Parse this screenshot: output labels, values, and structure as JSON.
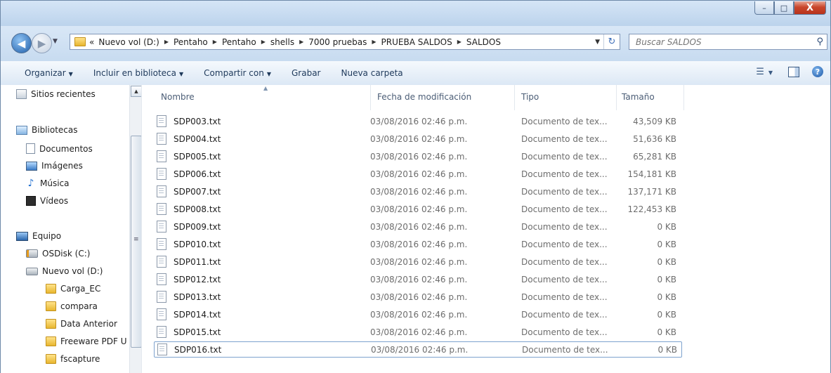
{
  "window": {
    "min_label": "–",
    "max_label": "□",
    "close_label": "X"
  },
  "nav_buttons": {
    "back_glyph": "◀",
    "forward_glyph": "▶",
    "drop_glyph": "▼"
  },
  "address": {
    "prefix": "«",
    "crumbs": [
      "Nuevo vol (D:)",
      "Pentaho",
      "Pentaho",
      "shells",
      "7000 pruebas",
      "PRUEBA SALDOS",
      "SALDOS"
    ],
    "sep_glyph": "▶",
    "dropdown_glyph": "▼",
    "refresh_glyph": "↻"
  },
  "search": {
    "placeholder": "Buscar SALDOS",
    "icon_glyph": "⚲"
  },
  "toolbar": {
    "organize": "Organizar",
    "include": "Incluir en biblioteca",
    "share": "Compartir con",
    "burn": "Grabar",
    "new_folder": "Nueva carpeta",
    "caret": "▼",
    "views_glyph": "☰",
    "preview_glyph": "▯",
    "help_glyph": "?"
  },
  "nav_pane": {
    "recent": "Sitios recientes",
    "libraries": "Bibliotecas",
    "documents": "Documentos",
    "images": "Imágenes",
    "music": "Música",
    "videos": "Vídeos",
    "computer": "Equipo",
    "osdisk": "OSDisk (C:)",
    "nuevo": "Nuevo vol (D:)",
    "folders": [
      "Carga_EC",
      "compara",
      "Data Anterior",
      "Freeware PDF U",
      "fscapture"
    ],
    "music_glyph": "♪",
    "scroll_up_glyph": "▲",
    "grip_glyph": "≡"
  },
  "columns": {
    "name": "Nombre",
    "date": "Fecha de modificación",
    "type": "Tipo",
    "size": "Tamaño",
    "sort_glyph": "▲"
  },
  "files": [
    {
      "name": "SDP003.txt",
      "date": "03/08/2016 02:46 p.m.",
      "type": "Documento de tex...",
      "size": "43,509 KB"
    },
    {
      "name": "SDP004.txt",
      "date": "03/08/2016 02:46 p.m.",
      "type": "Documento de tex...",
      "size": "51,636 KB"
    },
    {
      "name": "SDP005.txt",
      "date": "03/08/2016 02:46 p.m.",
      "type": "Documento de tex...",
      "size": "65,281 KB"
    },
    {
      "name": "SDP006.txt",
      "date": "03/08/2016 02:46 p.m.",
      "type": "Documento de tex...",
      "size": "154,181 KB"
    },
    {
      "name": "SDP007.txt",
      "date": "03/08/2016 02:46 p.m.",
      "type": "Documento de tex...",
      "size": "137,171 KB"
    },
    {
      "name": "SDP008.txt",
      "date": "03/08/2016 02:46 p.m.",
      "type": "Documento de tex...",
      "size": "122,453 KB"
    },
    {
      "name": "SDP009.txt",
      "date": "03/08/2016 02:46 p.m.",
      "type": "Documento de tex...",
      "size": "0 KB"
    },
    {
      "name": "SDP010.txt",
      "date": "03/08/2016 02:46 p.m.",
      "type": "Documento de tex...",
      "size": "0 KB"
    },
    {
      "name": "SDP011.txt",
      "date": "03/08/2016 02:46 p.m.",
      "type": "Documento de tex...",
      "size": "0 KB"
    },
    {
      "name": "SDP012.txt",
      "date": "03/08/2016 02:46 p.m.",
      "type": "Documento de tex...",
      "size": "0 KB"
    },
    {
      "name": "SDP013.txt",
      "date": "03/08/2016 02:46 p.m.",
      "type": "Documento de tex...",
      "size": "0 KB"
    },
    {
      "name": "SDP014.txt",
      "date": "03/08/2016 02:46 p.m.",
      "type": "Documento de tex...",
      "size": "0 KB"
    },
    {
      "name": "SDP015.txt",
      "date": "03/08/2016 02:46 p.m.",
      "type": "Documento de tex...",
      "size": "0 KB"
    },
    {
      "name": "SDP016.txt",
      "date": "03/08/2016 02:46 p.m.",
      "type": "Documento de tex...",
      "size": "0 KB"
    }
  ],
  "focused_file": "SDP016.txt",
  "colors": {
    "accent": "#3d6eb8",
    "close": "#c9462c",
    "chrome": "#c5d9ee"
  }
}
